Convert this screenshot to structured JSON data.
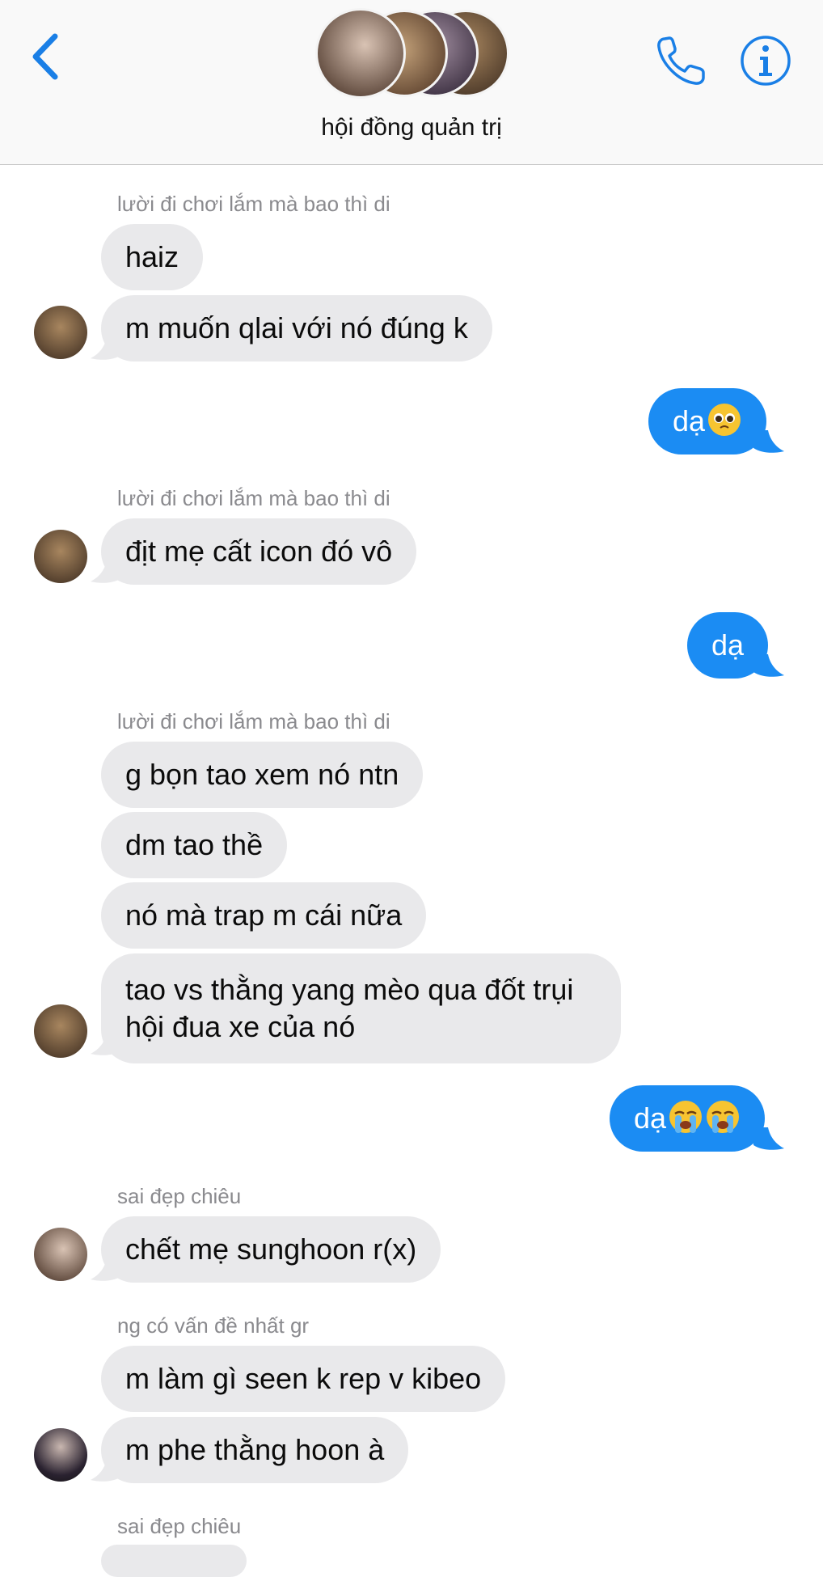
{
  "header": {
    "title": "hội đồng quản trị",
    "accent": "#1a7fe6"
  },
  "senders": {
    "s1": "lười đi chơi lắm mà bao thì di",
    "s2": "sai đẹp chiêu",
    "s3": "ng có vấn đề nhất gr"
  },
  "messages": {
    "m1": "haiz",
    "m2": "m muốn qlai với nó đúng k",
    "m3": "dạ",
    "m4": "địt mẹ cất icon đó vô",
    "m5": "dạ",
    "m6": "g bọn tao xem nó ntn",
    "m7": "dm tao thề",
    "m8": "nó mà trap m cái nữa",
    "m9": "tao vs thằng yang mèo qua đốt trụi hội đua xe của nó",
    "m10": "dạ",
    "m11": "chết mẹ sunghoon r(x)",
    "m12": "m làm gì seen k rep v kibeo",
    "m13": "m phe thằng hoon à"
  },
  "colors": {
    "incoming_bubble": "#e9e9eb",
    "outgoing_bubble": "#1b8cf3"
  }
}
